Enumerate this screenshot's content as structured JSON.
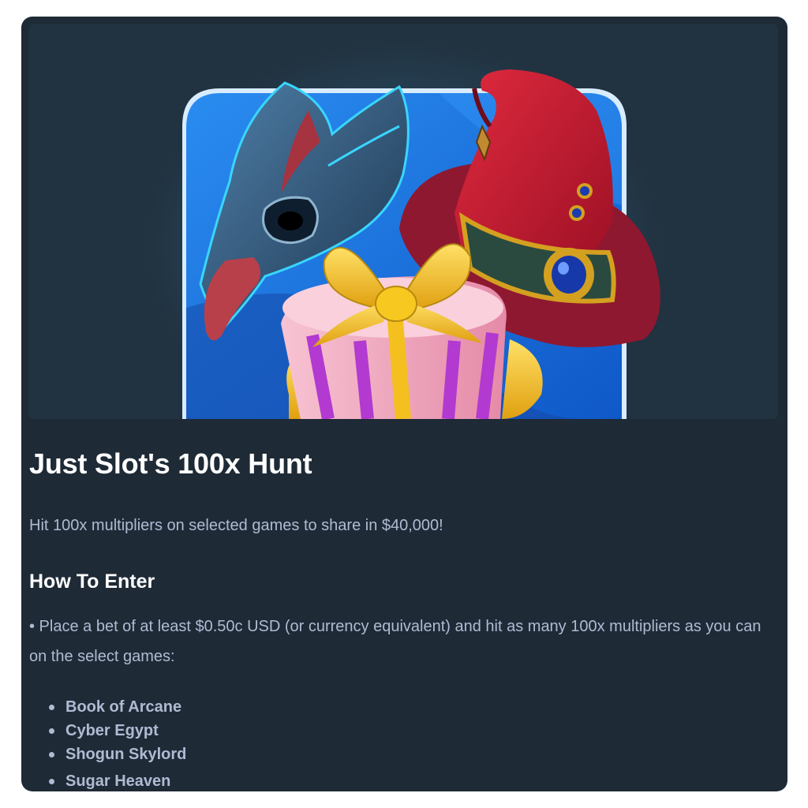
{
  "promo": {
    "title": "Just Slot's 100x Hunt",
    "subtitle": "Hit 100x multipliers on selected games to share in $40,000!",
    "how_to_enter": {
      "heading": "How To Enter",
      "instruction": "• Place a bet of at least $0.50c USD (or currency equivalent) and hit as many 100x multipliers as you can on the select games:",
      "games": [
        {
          "label": "Book of Arcane"
        },
        {
          "label": "Cyber Egypt"
        },
        {
          "label": "Shogun Skylord"
        },
        {
          "label": "Sugar Heaven"
        }
      ]
    }
  },
  "hero_image": {
    "elements": [
      "eagle-mask-icon",
      "gift-box-icon",
      "wizard-hat-icon"
    ],
    "colors": {
      "panel": "#1e2a36",
      "hero_bg": "#213240",
      "tile_blue": "#1a6fe0",
      "hat_red": "#c8182e",
      "gift_pink": "#f2a9c0",
      "ribbon_gold": "#f4c020",
      "text_white": "#ffffff",
      "text_muted": "#b1bad3"
    }
  }
}
